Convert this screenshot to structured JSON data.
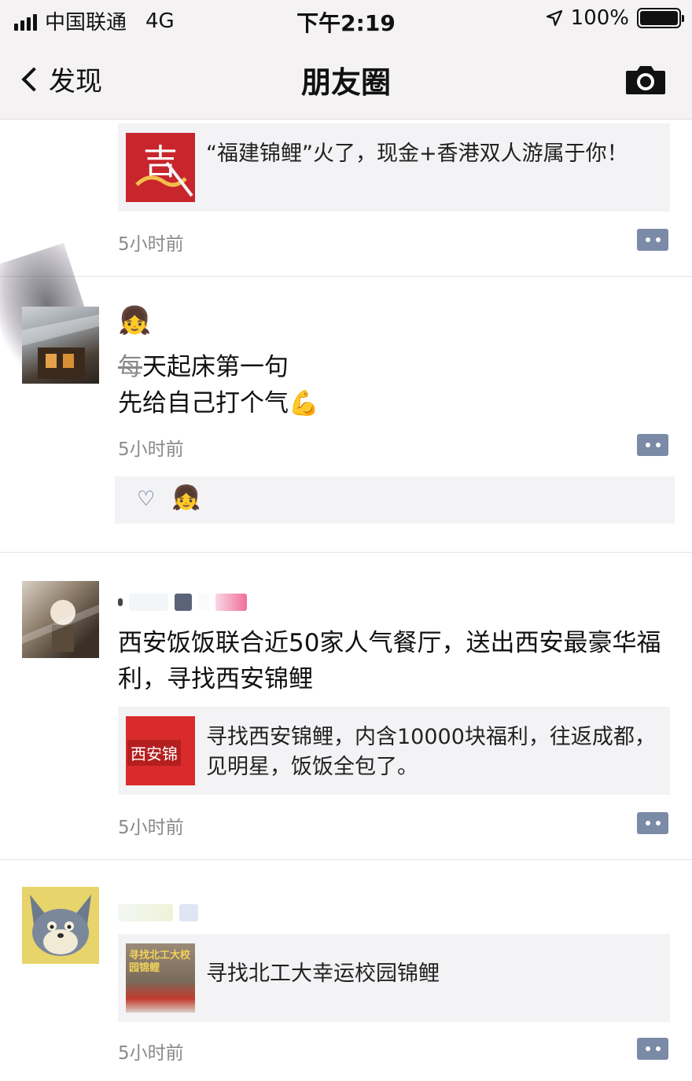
{
  "status_bar": {
    "carrier": "中国联通",
    "network": "4G",
    "time": "下午2:19",
    "battery": "100%"
  },
  "nav": {
    "back_label": "发现",
    "title": "朋友圈"
  },
  "posts": [
    {
      "link": {
        "text": "“福建锦鲤”火了，现金+香港双人游属于你！"
      },
      "time": "5小时前"
    },
    {
      "text_line1_strike": "每",
      "text_line1_rest": "天起床第一句",
      "text_line2": "先给自己打个气",
      "emoji_top": "👧",
      "emoji_muscle": "💪",
      "time": "5小时前",
      "likes": [
        "👧"
      ]
    },
    {
      "text": "西安饭饭联合近50家人气餐厅，送出西安最豪华福利，寻找西安锦鲤",
      "link": {
        "thumb_label": "西安锦",
        "text": "寻找西安锦鲤，内含10000块福利，往返成都，见明星，饭饭全包了。"
      },
      "time": "5小时前"
    },
    {
      "link": {
        "thumb_label": "寻找北工大校园锦鲤",
        "text": "寻找北工大幸运校园锦鲤"
      },
      "time": "5小时前"
    }
  ],
  "colors": {
    "accent_link": "#51618a",
    "more_button": "#7b8aa6",
    "card_bg": "#f3f3f5"
  }
}
